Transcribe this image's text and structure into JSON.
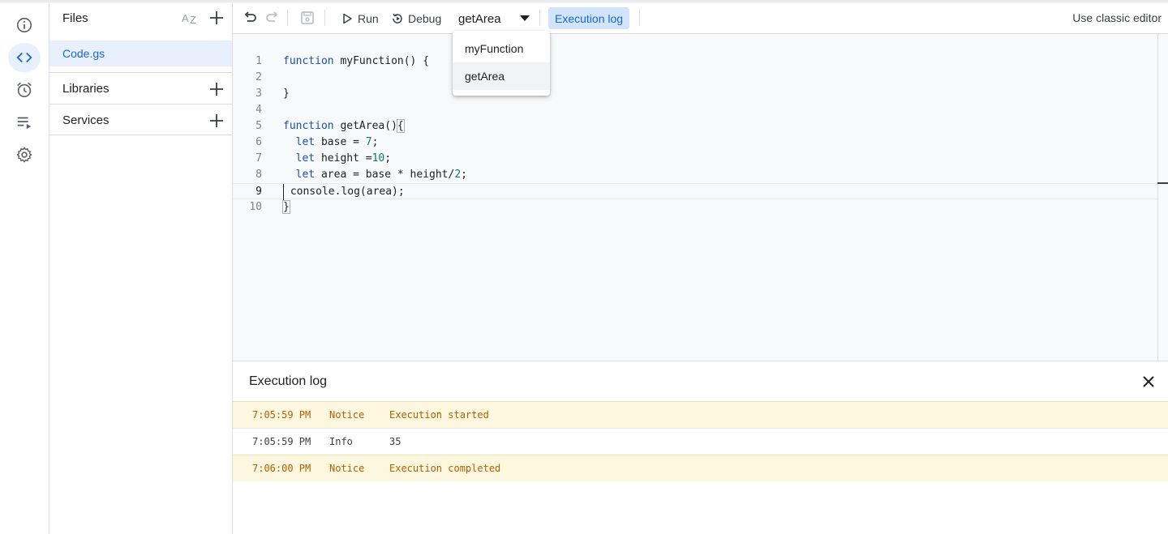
{
  "rail": {
    "items": [
      {
        "icon": "info-icon",
        "active": false
      },
      {
        "icon": "code-icon",
        "active": true
      },
      {
        "icon": "alarm-clock-icon",
        "active": false
      },
      {
        "icon": "executions-icon",
        "active": false
      },
      {
        "icon": "gear-icon",
        "active": false
      }
    ]
  },
  "files_panel": {
    "title": "Files",
    "files": [
      {
        "name": "Code.gs",
        "selected": true
      }
    ],
    "sections": [
      {
        "label": "Libraries"
      },
      {
        "label": "Services"
      }
    ]
  },
  "toolbar": {
    "run_label": "Run",
    "debug_label": "Debug",
    "selected_function": "getArea",
    "exec_log_label": "Execution log",
    "classic_label": "Use classic editor"
  },
  "function_menu": {
    "options": [
      "myFunction",
      "getArea"
    ],
    "selected": "getArea"
  },
  "editor": {
    "current_line": 9,
    "lines": [
      {
        "n": "1",
        "text": "function myFunction() {"
      },
      {
        "n": "2",
        "text": ""
      },
      {
        "n": "3",
        "text": "}"
      },
      {
        "n": "4",
        "text": ""
      },
      {
        "n": "5",
        "text": "function getArea(){"
      },
      {
        "n": "6",
        "text": "  let base = 7;"
      },
      {
        "n": "7",
        "text": "  let height =10;"
      },
      {
        "n": "8",
        "text": "  let area = base * height/2;"
      },
      {
        "n": "9",
        "text": " console.log(area);"
      },
      {
        "n": "10",
        "text": "}"
      }
    ]
  },
  "execution_log": {
    "title": "Execution log",
    "rows": [
      {
        "time": "7:05:59 PM",
        "level": "Notice",
        "message": "Execution started"
      },
      {
        "time": "7:05:59 PM",
        "level": "Info",
        "message": "35"
      },
      {
        "time": "7:06:00 PM",
        "level": "Notice",
        "message": "Execution completed"
      }
    ]
  },
  "colors": {
    "accent": "#1967d2",
    "selection_bg": "#e8f0fe",
    "notice_bg": "#fef7e0",
    "notice_text": "#b06000"
  }
}
